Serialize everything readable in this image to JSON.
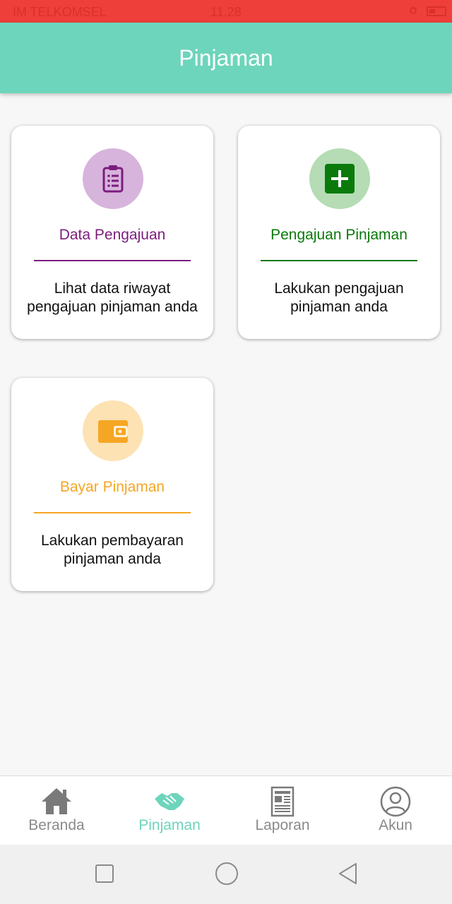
{
  "status_bar": {
    "carrier": "IM TELKOMSEL",
    "time": "11.28"
  },
  "appbar": {
    "title": "Pinjaman"
  },
  "cards": [
    {
      "title": "Data Pengajuan",
      "description": "Lihat data riwayat\npengajuan pinjaman anda",
      "icon": "clipboard-list-icon",
      "accent": "#7b1d7e",
      "circle_color": "#d7b4dc"
    },
    {
      "title": "Pengajuan Pinjaman",
      "description": "Lakukan pengajuan\npinjaman anda",
      "icon": "plus-box-icon",
      "accent": "#0a7a0a",
      "circle_color": "#b5dcb5"
    },
    {
      "title": "Bayar Pinjaman",
      "description": "Lakukan pembayaran\npinjaman anda",
      "icon": "wallet-icon",
      "accent": "#f5a623",
      "circle_color": "#fde2b4"
    }
  ],
  "bottom_nav": [
    {
      "label": "Beranda",
      "icon": "home-icon",
      "active": false
    },
    {
      "label": "Pinjaman",
      "icon": "handshake-icon",
      "active": true
    },
    {
      "label": "Laporan",
      "icon": "newspaper-icon",
      "active": false
    },
    {
      "label": "Akun",
      "icon": "user-circle-icon",
      "active": false
    }
  ],
  "colors": {
    "primary": "#6dd5bb",
    "status_bar": "#ef3f3a",
    "inactive_nav": "#8a8a8a"
  }
}
